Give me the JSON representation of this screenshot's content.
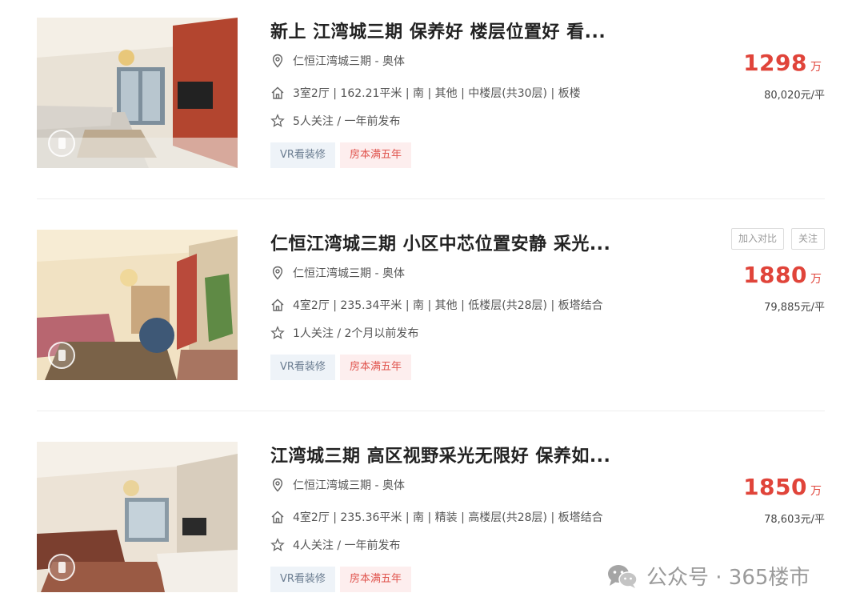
{
  "listings": [
    {
      "title": "新上 江湾城三期 保养好 楼层位置好 看...",
      "address": "仁恒江湾城三期 - 奥体",
      "info": "3室2厅 | 162.21平米 | 南 | 其他 | 中楼层(共30层) | 板楼",
      "follow": "5人关注 / 一年前发布",
      "tags": {
        "vr": "VR看装修",
        "years": "房本满五年"
      },
      "price": "1298",
      "price_unit": "万",
      "unit_price": "80,020元/平",
      "photo_icon": "living-room-photo"
    },
    {
      "title": "仁恒江湾城三期 小区中芯位置安静 采光...",
      "address": "仁恒江湾城三期 - 奥体",
      "info": "4室2厅 | 235.34平米 | 南 | 其他 | 低楼层(共28层) | 板塔结合",
      "follow": "1人关注 / 2个月以前发布",
      "tags": {
        "vr": "VR看装修",
        "years": "房本满五年"
      },
      "price": "1880",
      "price_unit": "万",
      "unit_price": "79,885元/平",
      "buttons": {
        "compare": "加入对比",
        "follow": "关注"
      },
      "photo_icon": "living-room-photo"
    },
    {
      "title": "江湾城三期 高区视野采光无限好 保养如...",
      "address": "仁恒江湾城三期 - 奥体",
      "info": "4室2厅 | 235.36平米 | 南 | 精装 | 高楼层(共28层) | 板塔结合",
      "follow": "4人关注 / 一年前发布",
      "tags": {
        "vr": "VR看装修",
        "years": "房本满五年"
      },
      "price": "1850",
      "price_unit": "万",
      "unit_price": "78,603元/平",
      "photo_icon": "living-room-photo"
    }
  ],
  "watermark": {
    "text": "公众号 · 365楼市",
    "icon": "wechat-icon"
  },
  "colors": {
    "price": "#e0443a",
    "tag_vr_bg": "#eef3f8",
    "tag_years_bg": "#fdeeee",
    "tag_years_text": "#e0554f"
  }
}
